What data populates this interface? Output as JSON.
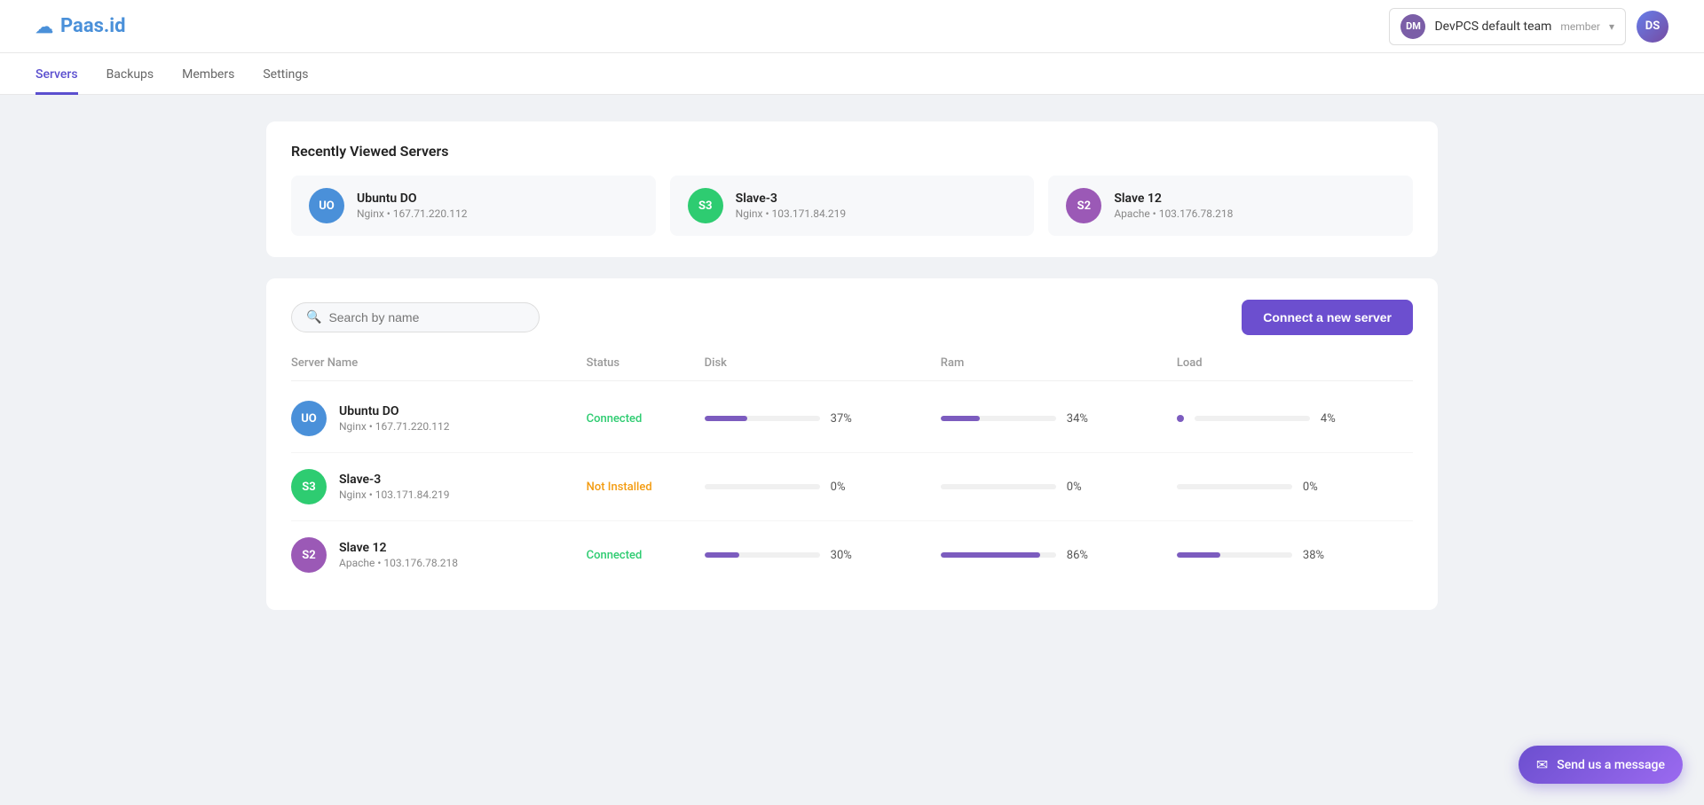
{
  "logo": {
    "icon": "☁",
    "text": "Paas.id"
  },
  "team": {
    "initials": "DM",
    "name": "DevPCS default team",
    "role": "member"
  },
  "user": {
    "initials": "DS"
  },
  "nav": {
    "items": [
      {
        "label": "Servers",
        "active": true
      },
      {
        "label": "Backups",
        "active": false
      },
      {
        "label": "Members",
        "active": false
      },
      {
        "label": "Settings",
        "active": false
      }
    ]
  },
  "recently_viewed": {
    "title": "Recently Viewed Servers",
    "servers": [
      {
        "initials": "UO",
        "avatar_class": "avatar-blue",
        "name": "Ubuntu DO",
        "meta": "Nginx • 167.71.220.112"
      },
      {
        "initials": "S3",
        "avatar_class": "avatar-green",
        "name": "Slave-3",
        "meta": "Nginx • 103.171.84.219"
      },
      {
        "initials": "S2",
        "avatar_class": "avatar-purple",
        "name": "Slave 12",
        "meta": "Apache • 103.176.78.218"
      }
    ]
  },
  "search": {
    "placeholder": "Search by name"
  },
  "connect_button": "Connect a new server",
  "table": {
    "headers": [
      "Server Name",
      "Status",
      "Disk",
      "Ram",
      "Load"
    ],
    "rows": [
      {
        "initials": "UO",
        "avatar_class": "avatar-blue",
        "name": "Ubuntu DO",
        "meta": "Nginx • 167.71.220.112",
        "status": "Connected",
        "status_class": "status-connected",
        "disk_pct": 37,
        "disk_label": "37%",
        "ram_pct": 34,
        "ram_label": "34%",
        "load_pct": 4,
        "load_label": "4%",
        "load_type": "dot"
      },
      {
        "initials": "S3",
        "avatar_class": "avatar-green",
        "name": "Slave-3",
        "meta": "Nginx • 103.171.84.219",
        "status": "Not Installed",
        "status_class": "status-not-installed",
        "disk_pct": 0,
        "disk_label": "0%",
        "ram_pct": 0,
        "ram_label": "0%",
        "load_pct": 0,
        "load_label": "0%",
        "load_type": "bar"
      },
      {
        "initials": "S2",
        "avatar_class": "avatar-purple",
        "name": "Slave 12",
        "meta": "Apache • 103.176.78.218",
        "status": "Connected",
        "status_class": "status-connected",
        "disk_pct": 30,
        "disk_label": "30%",
        "ram_pct": 86,
        "ram_label": "86%",
        "load_pct": 38,
        "load_label": "38%",
        "load_type": "bar"
      }
    ]
  },
  "chat_widget": {
    "label": "Send us a message"
  }
}
